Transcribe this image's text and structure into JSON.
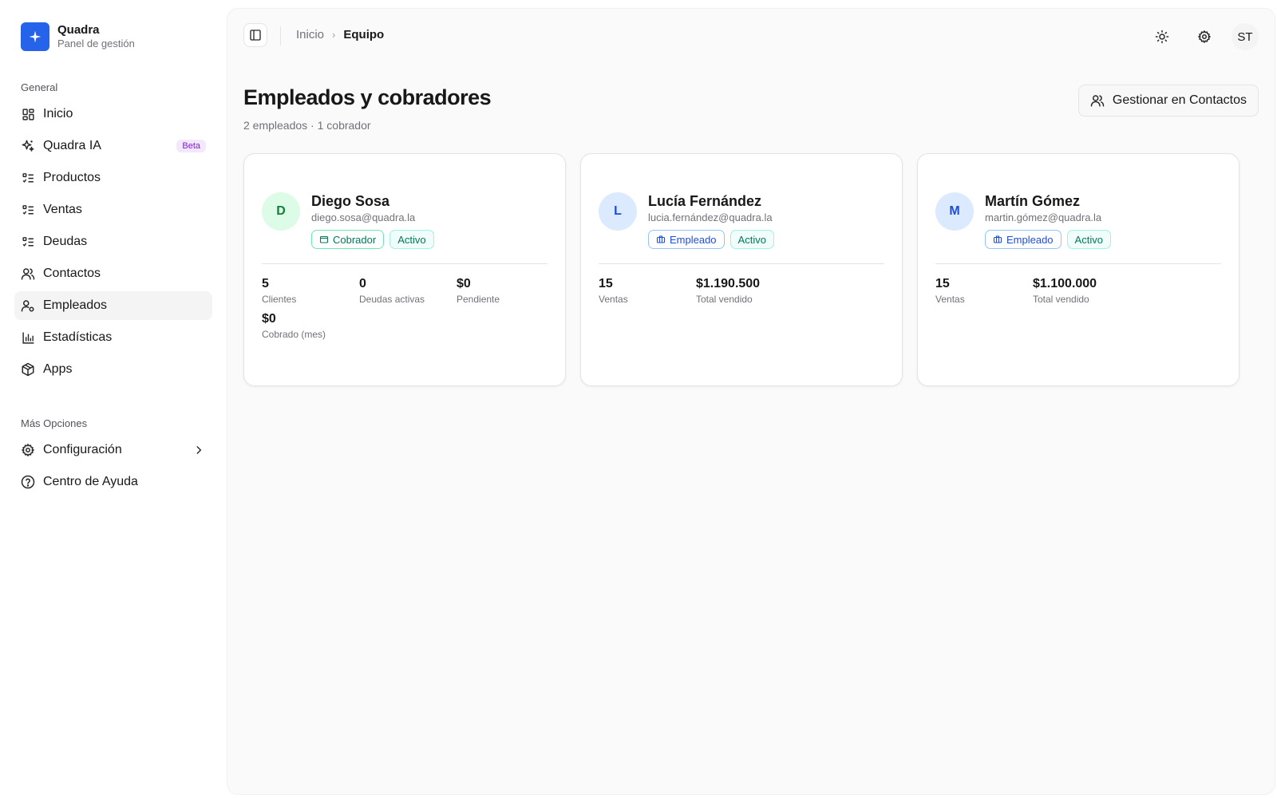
{
  "brand": {
    "name": "Quadra",
    "subtitle": "Panel de gestión"
  },
  "sidebar": {
    "section_general": "General",
    "items": [
      {
        "label": "Inicio",
        "icon": "dashboard-icon"
      },
      {
        "label": "Quadra IA",
        "icon": "sparkles-icon",
        "badge": "Beta"
      },
      {
        "label": "Productos",
        "icon": "list-icon"
      },
      {
        "label": "Ventas",
        "icon": "list-icon"
      },
      {
        "label": "Deudas",
        "icon": "list-icon"
      },
      {
        "label": "Contactos",
        "icon": "users-icon"
      },
      {
        "label": "Empleados",
        "icon": "user-cog-icon",
        "active": true
      },
      {
        "label": "Estadísticas",
        "icon": "bar-chart-icon"
      },
      {
        "label": "Apps",
        "icon": "package-icon"
      }
    ],
    "section_more": "Más Opciones",
    "more_items": [
      {
        "label": "Configuración",
        "icon": "gear-icon"
      },
      {
        "label": "Centro de Ayuda",
        "icon": "help-circle-icon"
      }
    ]
  },
  "topbar": {
    "breadcrumb_home": "Inicio",
    "breadcrumb_current": "Equipo",
    "avatar_initials": "ST"
  },
  "page": {
    "title": "Empleados y cobradores",
    "subtitle": "2 empleados · 1 cobrador",
    "manage_button": "Gestionar en Contactos"
  },
  "employees": [
    {
      "initial": "D",
      "name": "Diego Sosa",
      "email": "diego.sosa@quadra.la",
      "role": "Cobrador",
      "status": "Activo",
      "stats": [
        {
          "value": "5",
          "label": "Clientes"
        },
        {
          "value": "0",
          "label": "Deudas activas"
        },
        {
          "value": "$0",
          "label": "Pendiente"
        },
        {
          "value": "$0",
          "label": "Cobrado (mes)"
        }
      ]
    },
    {
      "initial": "L",
      "name": "Lucía Fernández",
      "email": "lucia.fernández@quadra.la",
      "role": "Empleado",
      "status": "Activo",
      "stats": [
        {
          "value": "15",
          "label": "Ventas"
        },
        {
          "value": "$1.190.500",
          "label": "Total vendido"
        }
      ]
    },
    {
      "initial": "M",
      "name": "Martín Gómez",
      "email": "martin.gómez@quadra.la",
      "role": "Empleado",
      "status": "Activo",
      "stats": [
        {
          "value": "15",
          "label": "Ventas"
        },
        {
          "value": "$1.100.000",
          "label": "Total vendido"
        }
      ]
    }
  ],
  "colors": {
    "brand": "#2563eb",
    "beta": "#7e22ce",
    "cobrador": "#047857",
    "empleado": "#1d4ed8",
    "activo": "#047857"
  }
}
